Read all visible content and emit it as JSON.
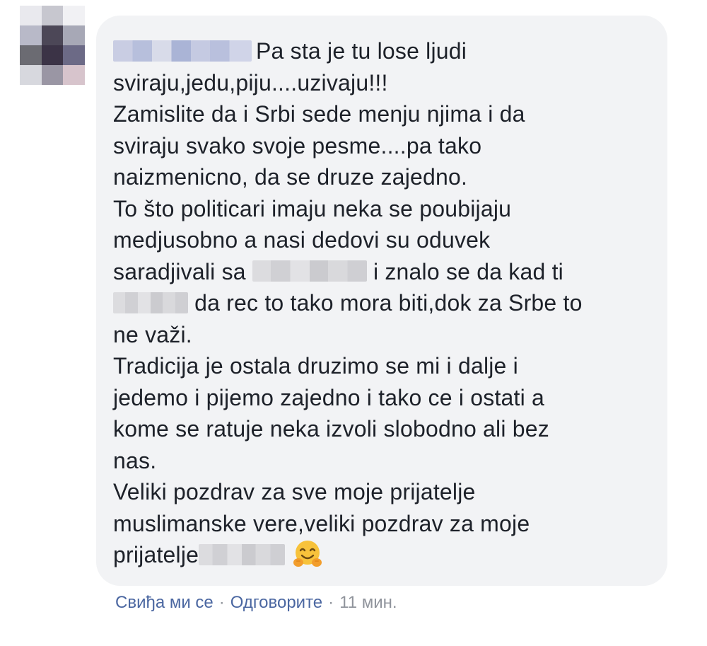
{
  "comment": {
    "line_1_suffix": "Pa sta je tu lose ljudi",
    "line_2": "sviraju,jedu,piju....uzivaju!!!",
    "line_3": "Zamislite da i Srbi sede menju njima i da",
    "line_4": "sviraju svako svoje pesme....pa tako",
    "line_5": "naizmenicno, da se druze zajedno.",
    "line_6": "To što politicari imaju neka se poubijaju",
    "line_7": "medjusobno a nasi dedovi su oduvek",
    "line_8_prefix": "saradjivali sa ",
    "line_8_suffix": " i znalo se da kad ti",
    "line_9_suffix": " da rec to tako mora biti,dok za Srbe to",
    "line_10": "ne važi.",
    "line_11": "Tradicija je ostala druzimo se mi i dalje i",
    "line_12": "jedemo i pijemo zajedno i tako ce i ostati a",
    "line_13": "kome se ratuje neka izvoli slobodno ali bez",
    "line_14": "nas.",
    "line_15": "Veliki pozdrav za sve moje prijatelje",
    "line_16": "muslimanske vere,veliki pozdrav za moje",
    "line_17_prefix": "prijatelje",
    "emoji": "hugging-face-icon"
  },
  "actions": {
    "like_label": "Свиђа ми се",
    "separator": "·",
    "reply_label": "Одговорите",
    "timestamp": "11 мин."
  },
  "colors": {
    "bubble_bg": "#f2f3f5",
    "text": "#1d2129",
    "link": "#4b67a1",
    "meta": "#90949c"
  }
}
